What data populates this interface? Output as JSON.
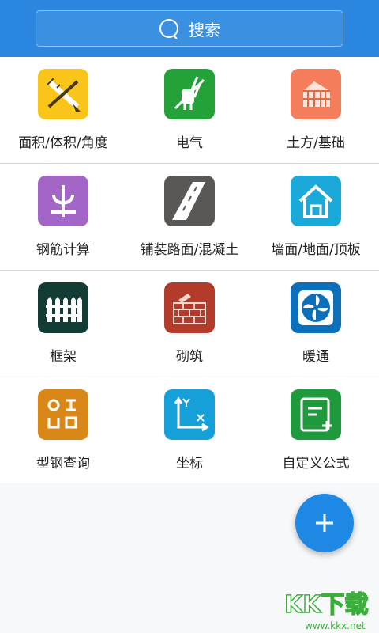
{
  "search": {
    "label": "搜索",
    "icon": "search-icon"
  },
  "items": [
    {
      "label": "面积/体积/角度",
      "icon": "ruler-pencil-icon",
      "color": "#f9c51b"
    },
    {
      "label": "电气",
      "icon": "electric-plug-icon",
      "color": "#25a139"
    },
    {
      "label": "土方/基础",
      "icon": "soil-foundation-icon",
      "color": "#f47e5c"
    },
    {
      "label": "钢筋计算",
      "icon": "rebar-icon",
      "color": "#a366c7"
    },
    {
      "label": "铺装路面/混凝土",
      "icon": "road-icon",
      "color": "#5a5856"
    },
    {
      "label": "墙面/地面/顶板",
      "icon": "house-icon",
      "color": "#1aa9d8"
    },
    {
      "label": "框架",
      "icon": "fence-icon",
      "color": "#123c34"
    },
    {
      "label": "砌筑",
      "icon": "brick-wall-icon",
      "color": "#b23b2b"
    },
    {
      "label": "暖通",
      "icon": "fan-icon",
      "color": "#0b70b9"
    },
    {
      "label": "型钢查询",
      "icon": "steel-section-icon",
      "color": "#d98716"
    },
    {
      "label": "坐标",
      "icon": "coordinate-axes-icon",
      "color": "#16a0da"
    },
    {
      "label": "自定义公式",
      "icon": "formula-icon",
      "color": "#1e9a3c"
    }
  ],
  "fab": {
    "icon": "plus-icon",
    "color": "#1e88e5"
  },
  "watermark": {
    "brand": "KK下载",
    "url": "www.kkx.net"
  }
}
